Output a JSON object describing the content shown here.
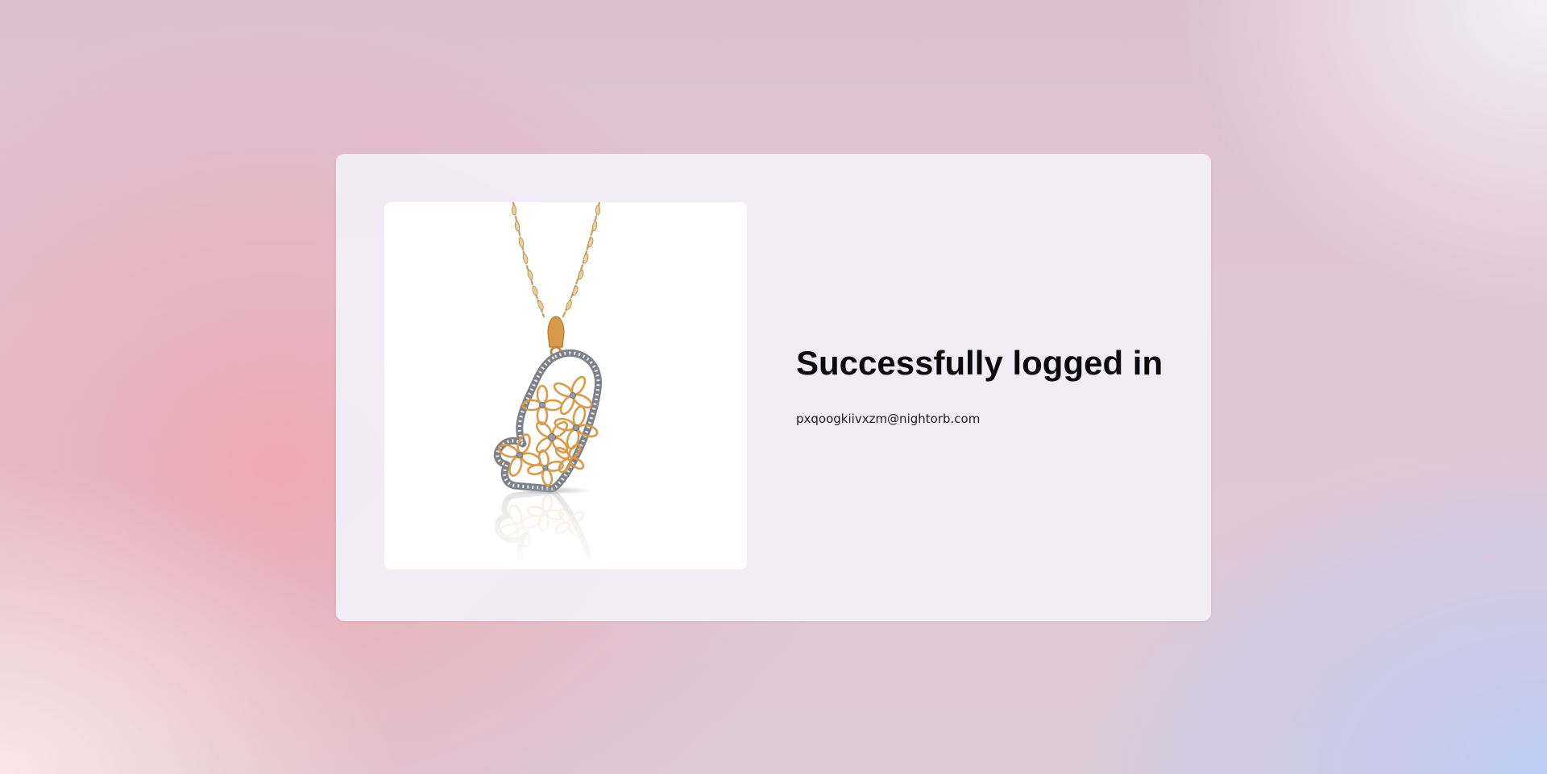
{
  "login_status": {
    "title": "Successfully logged in",
    "email": "pxqoogkiivxzm@nightorb.com"
  },
  "product_image": {
    "icon": "heart-pendant-necklace-image",
    "metal_color": "#d99b4a",
    "stone_color": "#8a8d93"
  }
}
